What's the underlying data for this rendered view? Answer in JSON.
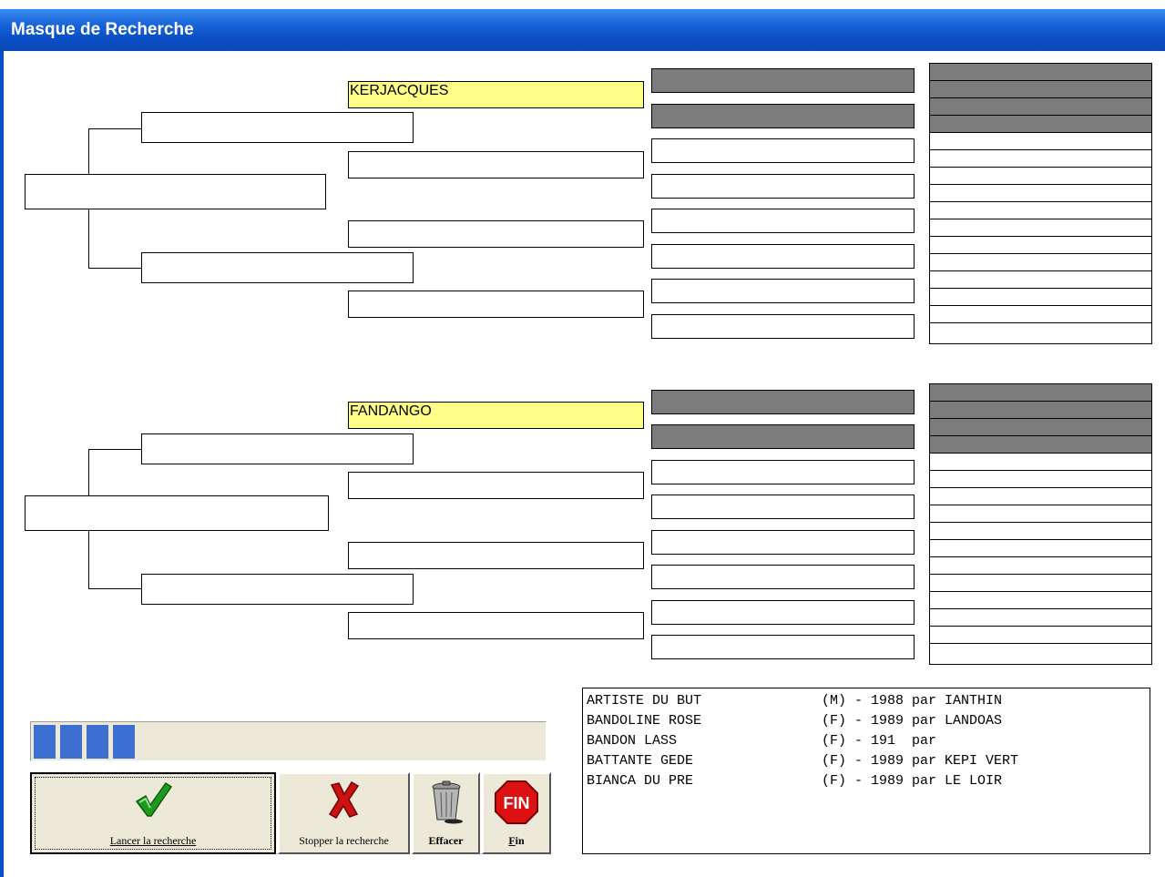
{
  "window": {
    "title": "Masque de Recherche"
  },
  "pedigree_top": {
    "sire_name": "KERJACQUES"
  },
  "pedigree_bottom": {
    "sire_name": "FANDANGO"
  },
  "progress": {
    "filled_segments": 4
  },
  "buttons": {
    "launch": "Lancer la recherche",
    "stop": "Stopper la recherche",
    "clear": "Effacer",
    "end": "Fin",
    "end_icon_text": "FIN"
  },
  "results": [
    {
      "name": "ARTISTE DU BUT",
      "info": "(M) - 1988 par IANTHIN"
    },
    {
      "name": "BANDOLINE ROSE",
      "info": "(F) - 1989 par LANDOAS"
    },
    {
      "name": "BANDON LASS",
      "info": "(F) - 191  par"
    },
    {
      "name": "BATTANTE GEDE",
      "info": "(F) - 1989 par KEPI VERT"
    },
    {
      "name": "BIANCA DU PRE",
      "info": "(F) - 1989 par LE LOIR"
    }
  ],
  "icons": {
    "launch": "green-check-icon",
    "stop": "red-x-icon",
    "clear": "trash-can-icon",
    "end": "stop-sign-icon"
  },
  "colors": {
    "title_bar": "#0a4fc6",
    "highlight": "#ffff88",
    "filled_cell": "#7c7c7c",
    "progress": "#3c6fd1"
  }
}
